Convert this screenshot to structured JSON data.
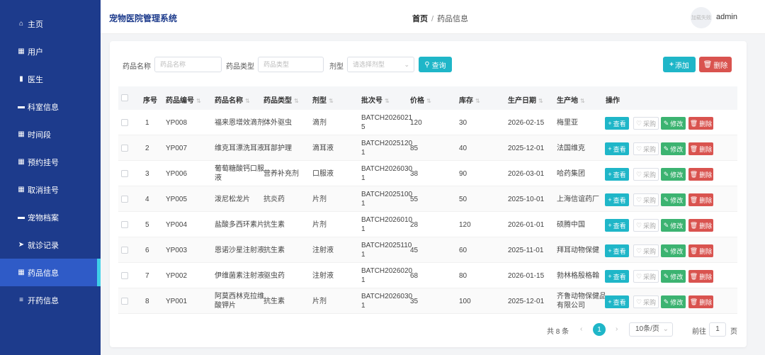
{
  "app": {
    "title": "宠物医院管理系统"
  },
  "breadcrumb": {
    "home": "首页",
    "sep": "/",
    "current": "药品信息"
  },
  "user": {
    "avatar_text": "加载失败",
    "name": "admin"
  },
  "sidebar": {
    "items": [
      {
        "icon": "home-icon",
        "glyph": "⌂",
        "label": "主页"
      },
      {
        "icon": "grid-icon",
        "glyph": "▦",
        "label": "用户"
      },
      {
        "icon": "bar-chart-icon",
        "glyph": "▮",
        "label": "医生"
      },
      {
        "icon": "monitor-icon",
        "glyph": "▬",
        "label": "科室信息"
      },
      {
        "icon": "grid-icon",
        "glyph": "▦",
        "label": "时间段"
      },
      {
        "icon": "grid-icon",
        "glyph": "▦",
        "label": "预约挂号"
      },
      {
        "icon": "grid-icon",
        "glyph": "▦",
        "label": "取消挂号"
      },
      {
        "icon": "drive-icon",
        "glyph": "▬",
        "label": "宠物档案"
      },
      {
        "icon": "send-icon",
        "glyph": "➤",
        "label": "就诊记录"
      },
      {
        "icon": "grid-icon",
        "glyph": "▦",
        "label": "药品信息",
        "active": true
      },
      {
        "icon": "list-icon",
        "glyph": "≡",
        "label": "开药信息"
      }
    ]
  },
  "filters": {
    "name_label": "药品名称",
    "name_placeholder": "药品名称",
    "type_label": "药品类型",
    "type_placeholder": "药品类型",
    "form_label": "剂型",
    "form_placeholder": "请选择剂型",
    "search_label": "查询",
    "add_label": "添加",
    "delete_label": "删除"
  },
  "table": {
    "columns": [
      "序号",
      "药品编号",
      "药品名称",
      "药品类型",
      "剂型",
      "批次号",
      "价格",
      "库存",
      "生产日期",
      "生产地",
      "操作"
    ],
    "rows": [
      {
        "no": "1",
        "code": "YP008",
        "name": "福来恩增效滴剂",
        "type": "体外驱虫",
        "form": "滴剂",
        "batch": "BATCH2026021\n5",
        "price": "120",
        "stock": "30",
        "date": "2026-02-15",
        "origin": "梅里亚"
      },
      {
        "no": "2",
        "code": "YP007",
        "name": "维克耳漂洗耳液",
        "type": "耳部护理",
        "form": "滴耳液",
        "batch": "BATCH2025120\n1",
        "price": "85",
        "stock": "40",
        "date": "2025-12-01",
        "origin": "法国维克"
      },
      {
        "no": "3",
        "code": "YP006",
        "name": "葡萄糖酸钙口服\n液",
        "type": "营养补充剂",
        "form": "口服液",
        "batch": "BATCH2026030\n1",
        "price": "38",
        "stock": "90",
        "date": "2026-03-01",
        "origin": "哈药集团"
      },
      {
        "no": "4",
        "code": "YP005",
        "name": "泼尼松龙片",
        "type": "抗炎药",
        "form": "片剂",
        "batch": "BATCH2025100\n1",
        "price": "55",
        "stock": "50",
        "date": "2025-10-01",
        "origin": "上海信谊药厂"
      },
      {
        "no": "5",
        "code": "YP004",
        "name": "盐酸多西环素片",
        "type": "抗生素",
        "form": "片剂",
        "batch": "BATCH2026010\n1",
        "price": "28",
        "stock": "120",
        "date": "2026-01-01",
        "origin": "硕腾中国"
      },
      {
        "no": "6",
        "code": "YP003",
        "name": "恩诺沙星注射液",
        "type": "抗生素",
        "form": "注射液",
        "batch": "BATCH2025110\n1",
        "price": "45",
        "stock": "60",
        "date": "2025-11-01",
        "origin": "拜耳动物保健"
      },
      {
        "no": "7",
        "code": "YP002",
        "name": "伊维菌素注射液",
        "type": "驱虫药",
        "form": "注射液",
        "batch": "BATCH2026020\n1",
        "price": "68",
        "stock": "80",
        "date": "2026-01-15",
        "origin": "勃林格殷格翰"
      },
      {
        "no": "8",
        "code": "YP001",
        "name": "阿莫西林克拉维\n酸钾片",
        "type": "抗生素",
        "form": "片剂",
        "batch": "BATCH2026030\n1",
        "price": "35",
        "stock": "100",
        "date": "2025-12-01",
        "origin": "齐鲁动物保健品\n有限公司"
      }
    ],
    "actions": {
      "view": "查看",
      "buy": "采购",
      "edit": "修改",
      "delete": "删除"
    }
  },
  "pagination": {
    "total": "共 8 条",
    "prev": "‹",
    "current": "1",
    "next": "›",
    "page_size": "10条/页",
    "goto_label": "前往",
    "goto_value": "1",
    "page_unit": "页"
  },
  "colors": {
    "sidebar": "#1d3b8c",
    "accent": "#1fb6c8",
    "danger": "#d9534f",
    "success": "#3cb371"
  }
}
